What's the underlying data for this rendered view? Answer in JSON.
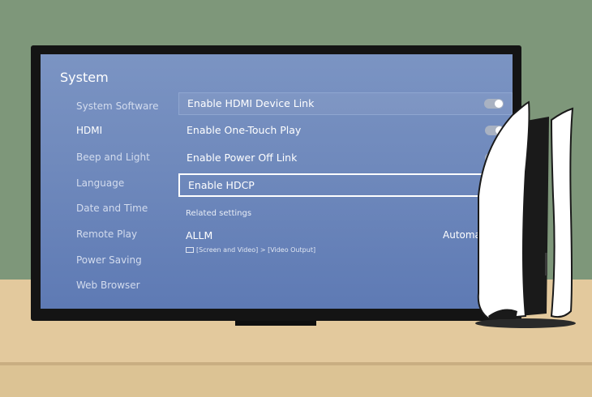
{
  "screen": {
    "title": "System",
    "menu": [
      {
        "label": "System Software"
      },
      {
        "label": "HDMI"
      },
      {
        "label": "Beep and Light"
      },
      {
        "label": "Language"
      },
      {
        "label": "Date and Time"
      },
      {
        "label": "Remote Play"
      },
      {
        "label": "Power Saving"
      },
      {
        "label": "Web Browser"
      }
    ],
    "active_menu": "HDMI",
    "settings": [
      {
        "label": "Enable HDMI Device Link",
        "state": "on"
      },
      {
        "label": "Enable One-Touch Play",
        "state": "on"
      },
      {
        "label": "Enable Power Off Link",
        "state": "on"
      },
      {
        "label": "Enable HDCP",
        "state": "off"
      }
    ],
    "related_label": "Related settings",
    "allm": {
      "label": "ALLM",
      "value": "Automati",
      "path": "[Screen and Video] > [Video Output]"
    }
  },
  "colors": {
    "wall": "#7e977a",
    "shelf": "#e3c99d",
    "screen_top": "#7b94c3",
    "screen_bottom": "#5e7ab4"
  }
}
